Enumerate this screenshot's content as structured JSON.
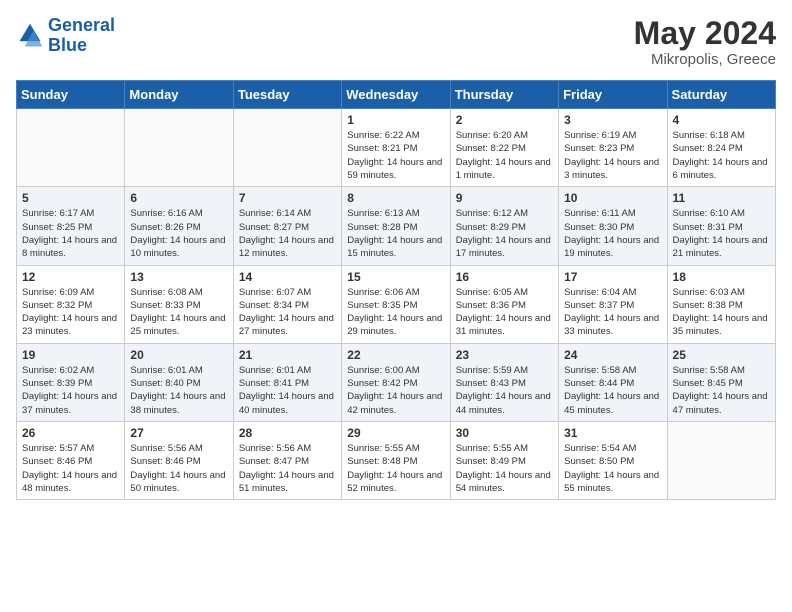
{
  "header": {
    "logo_line1": "General",
    "logo_line2": "Blue",
    "month": "May 2024",
    "location": "Mikropolis, Greece"
  },
  "days_of_week": [
    "Sunday",
    "Monday",
    "Tuesday",
    "Wednesday",
    "Thursday",
    "Friday",
    "Saturday"
  ],
  "weeks": [
    [
      {
        "day": "",
        "sunrise": "",
        "sunset": "",
        "daylight": ""
      },
      {
        "day": "",
        "sunrise": "",
        "sunset": "",
        "daylight": ""
      },
      {
        "day": "",
        "sunrise": "",
        "sunset": "",
        "daylight": ""
      },
      {
        "day": "1",
        "sunrise": "Sunrise: 6:22 AM",
        "sunset": "Sunset: 8:21 PM",
        "daylight": "Daylight: 14 hours and 59 minutes."
      },
      {
        "day": "2",
        "sunrise": "Sunrise: 6:20 AM",
        "sunset": "Sunset: 8:22 PM",
        "daylight": "Daylight: 14 hours and 1 minute."
      },
      {
        "day": "3",
        "sunrise": "Sunrise: 6:19 AM",
        "sunset": "Sunset: 8:23 PM",
        "daylight": "Daylight: 14 hours and 3 minutes."
      },
      {
        "day": "4",
        "sunrise": "Sunrise: 6:18 AM",
        "sunset": "Sunset: 8:24 PM",
        "daylight": "Daylight: 14 hours and 6 minutes."
      }
    ],
    [
      {
        "day": "5",
        "sunrise": "Sunrise: 6:17 AM",
        "sunset": "Sunset: 8:25 PM",
        "daylight": "Daylight: 14 hours and 8 minutes."
      },
      {
        "day": "6",
        "sunrise": "Sunrise: 6:16 AM",
        "sunset": "Sunset: 8:26 PM",
        "daylight": "Daylight: 14 hours and 10 minutes."
      },
      {
        "day": "7",
        "sunrise": "Sunrise: 6:14 AM",
        "sunset": "Sunset: 8:27 PM",
        "daylight": "Daylight: 14 hours and 12 minutes."
      },
      {
        "day": "8",
        "sunrise": "Sunrise: 6:13 AM",
        "sunset": "Sunset: 8:28 PM",
        "daylight": "Daylight: 14 hours and 15 minutes."
      },
      {
        "day": "9",
        "sunrise": "Sunrise: 6:12 AM",
        "sunset": "Sunset: 8:29 PM",
        "daylight": "Daylight: 14 hours and 17 minutes."
      },
      {
        "day": "10",
        "sunrise": "Sunrise: 6:11 AM",
        "sunset": "Sunset: 8:30 PM",
        "daylight": "Daylight: 14 hours and 19 minutes."
      },
      {
        "day": "11",
        "sunrise": "Sunrise: 6:10 AM",
        "sunset": "Sunset: 8:31 PM",
        "daylight": "Daylight: 14 hours and 21 minutes."
      }
    ],
    [
      {
        "day": "12",
        "sunrise": "Sunrise: 6:09 AM",
        "sunset": "Sunset: 8:32 PM",
        "daylight": "Daylight: 14 hours and 23 minutes."
      },
      {
        "day": "13",
        "sunrise": "Sunrise: 6:08 AM",
        "sunset": "Sunset: 8:33 PM",
        "daylight": "Daylight: 14 hours and 25 minutes."
      },
      {
        "day": "14",
        "sunrise": "Sunrise: 6:07 AM",
        "sunset": "Sunset: 8:34 PM",
        "daylight": "Daylight: 14 hours and 27 minutes."
      },
      {
        "day": "15",
        "sunrise": "Sunrise: 6:06 AM",
        "sunset": "Sunset: 8:35 PM",
        "daylight": "Daylight: 14 hours and 29 minutes."
      },
      {
        "day": "16",
        "sunrise": "Sunrise: 6:05 AM",
        "sunset": "Sunset: 8:36 PM",
        "daylight": "Daylight: 14 hours and 31 minutes."
      },
      {
        "day": "17",
        "sunrise": "Sunrise: 6:04 AM",
        "sunset": "Sunset: 8:37 PM",
        "daylight": "Daylight: 14 hours and 33 minutes."
      },
      {
        "day": "18",
        "sunrise": "Sunrise: 6:03 AM",
        "sunset": "Sunset: 8:38 PM",
        "daylight": "Daylight: 14 hours and 35 minutes."
      }
    ],
    [
      {
        "day": "19",
        "sunrise": "Sunrise: 6:02 AM",
        "sunset": "Sunset: 8:39 PM",
        "daylight": "Daylight: 14 hours and 37 minutes."
      },
      {
        "day": "20",
        "sunrise": "Sunrise: 6:01 AM",
        "sunset": "Sunset: 8:40 PM",
        "daylight": "Daylight: 14 hours and 38 minutes."
      },
      {
        "day": "21",
        "sunrise": "Sunrise: 6:01 AM",
        "sunset": "Sunset: 8:41 PM",
        "daylight": "Daylight: 14 hours and 40 minutes."
      },
      {
        "day": "22",
        "sunrise": "Sunrise: 6:00 AM",
        "sunset": "Sunset: 8:42 PM",
        "daylight": "Daylight: 14 hours and 42 minutes."
      },
      {
        "day": "23",
        "sunrise": "Sunrise: 5:59 AM",
        "sunset": "Sunset: 8:43 PM",
        "daylight": "Daylight: 14 hours and 44 minutes."
      },
      {
        "day": "24",
        "sunrise": "Sunrise: 5:58 AM",
        "sunset": "Sunset: 8:44 PM",
        "daylight": "Daylight: 14 hours and 45 minutes."
      },
      {
        "day": "25",
        "sunrise": "Sunrise: 5:58 AM",
        "sunset": "Sunset: 8:45 PM",
        "daylight": "Daylight: 14 hours and 47 minutes."
      }
    ],
    [
      {
        "day": "26",
        "sunrise": "Sunrise: 5:57 AM",
        "sunset": "Sunset: 8:46 PM",
        "daylight": "Daylight: 14 hours and 48 minutes."
      },
      {
        "day": "27",
        "sunrise": "Sunrise: 5:56 AM",
        "sunset": "Sunset: 8:46 PM",
        "daylight": "Daylight: 14 hours and 50 minutes."
      },
      {
        "day": "28",
        "sunrise": "Sunrise: 5:56 AM",
        "sunset": "Sunset: 8:47 PM",
        "daylight": "Daylight: 14 hours and 51 minutes."
      },
      {
        "day": "29",
        "sunrise": "Sunrise: 5:55 AM",
        "sunset": "Sunset: 8:48 PM",
        "daylight": "Daylight: 14 hours and 52 minutes."
      },
      {
        "day": "30",
        "sunrise": "Sunrise: 5:55 AM",
        "sunset": "Sunset: 8:49 PM",
        "daylight": "Daylight: 14 hours and 54 minutes."
      },
      {
        "day": "31",
        "sunrise": "Sunrise: 5:54 AM",
        "sunset": "Sunset: 8:50 PM",
        "daylight": "Daylight: 14 hours and 55 minutes."
      },
      {
        "day": "",
        "sunrise": "",
        "sunset": "",
        "daylight": ""
      }
    ]
  ]
}
